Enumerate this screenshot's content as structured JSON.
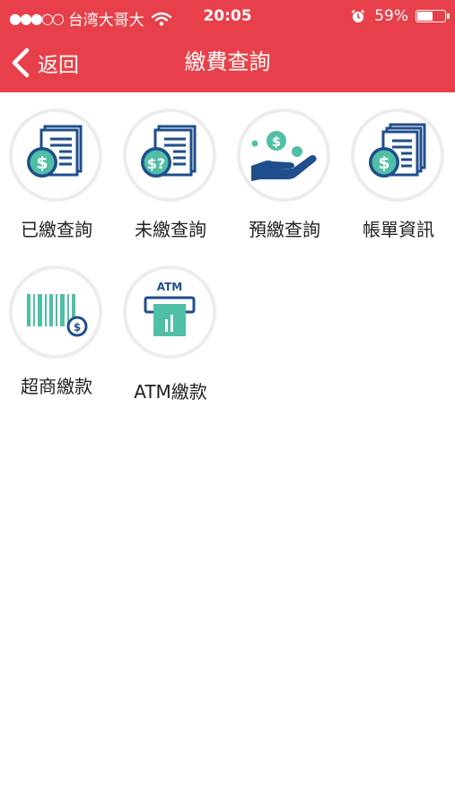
{
  "status_bar": {
    "signal": "●●●○○",
    "carrier": "台湾大哥大",
    "time": "20:05",
    "battery_text": "59%",
    "battery_level": 0.59
  },
  "nav": {
    "back_label": "返回",
    "title": "繳費查詢"
  },
  "colors": {
    "header_red": "#e8404a",
    "icon_navy": "#1f4e8c",
    "icon_teal": "#4fbfa5"
  },
  "tiles": [
    {
      "label": "已繳查詢",
      "icon": "paid-bill-icon"
    },
    {
      "label": "未繳查詢",
      "icon": "unpaid-bill-icon"
    },
    {
      "label": "預繳查詢",
      "icon": "prepay-hand-icon"
    },
    {
      "label": "帳單資訊",
      "icon": "bill-info-icon"
    },
    {
      "label": "超商繳款",
      "icon": "barcode-icon"
    },
    {
      "label": "ATM繳款",
      "icon": "atm-icon"
    }
  ]
}
